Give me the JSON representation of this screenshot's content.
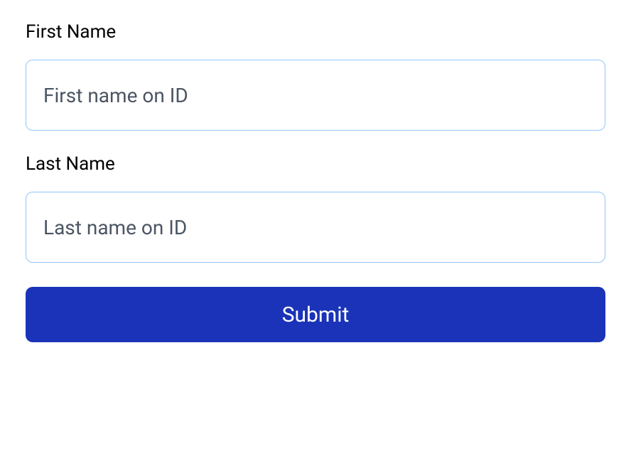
{
  "form": {
    "first_name": {
      "label": "First Name",
      "placeholder": "First name on ID",
      "value": ""
    },
    "last_name": {
      "label": "Last Name",
      "placeholder": "Last name on ID",
      "value": ""
    },
    "submit_label": "Submit"
  }
}
